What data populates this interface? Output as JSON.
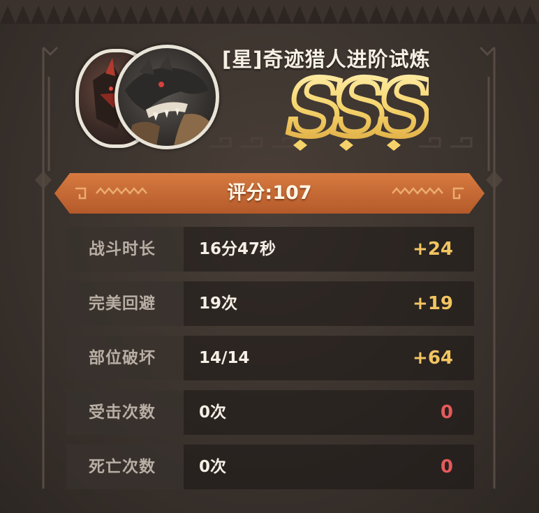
{
  "header": {
    "trial_title": "[星]奇迹猎人进阶试炼",
    "grade": "SSS"
  },
  "score": {
    "label": "评分:107"
  },
  "stats": [
    {
      "label": "战斗时长",
      "value": "16分47秒",
      "points": "+24"
    },
    {
      "label": "完美回避",
      "value": "19次",
      "points": "+19"
    },
    {
      "label": "部位破坏",
      "value": "14/14",
      "points": "+64"
    },
    {
      "label": "受击次数",
      "value": "0次",
      "points": "0"
    },
    {
      "label": "死亡次数",
      "value": "0次",
      "points": "0"
    }
  ],
  "colors": {
    "positive_points": "#f2c561",
    "zero_points": "#e55a5a",
    "ribbon": "#c86a35",
    "grade_gold": "#f5d36a"
  },
  "icons": {
    "avatar_back": "monster-portrait-red-horn",
    "avatar_front": "black-dragon-portrait"
  }
}
